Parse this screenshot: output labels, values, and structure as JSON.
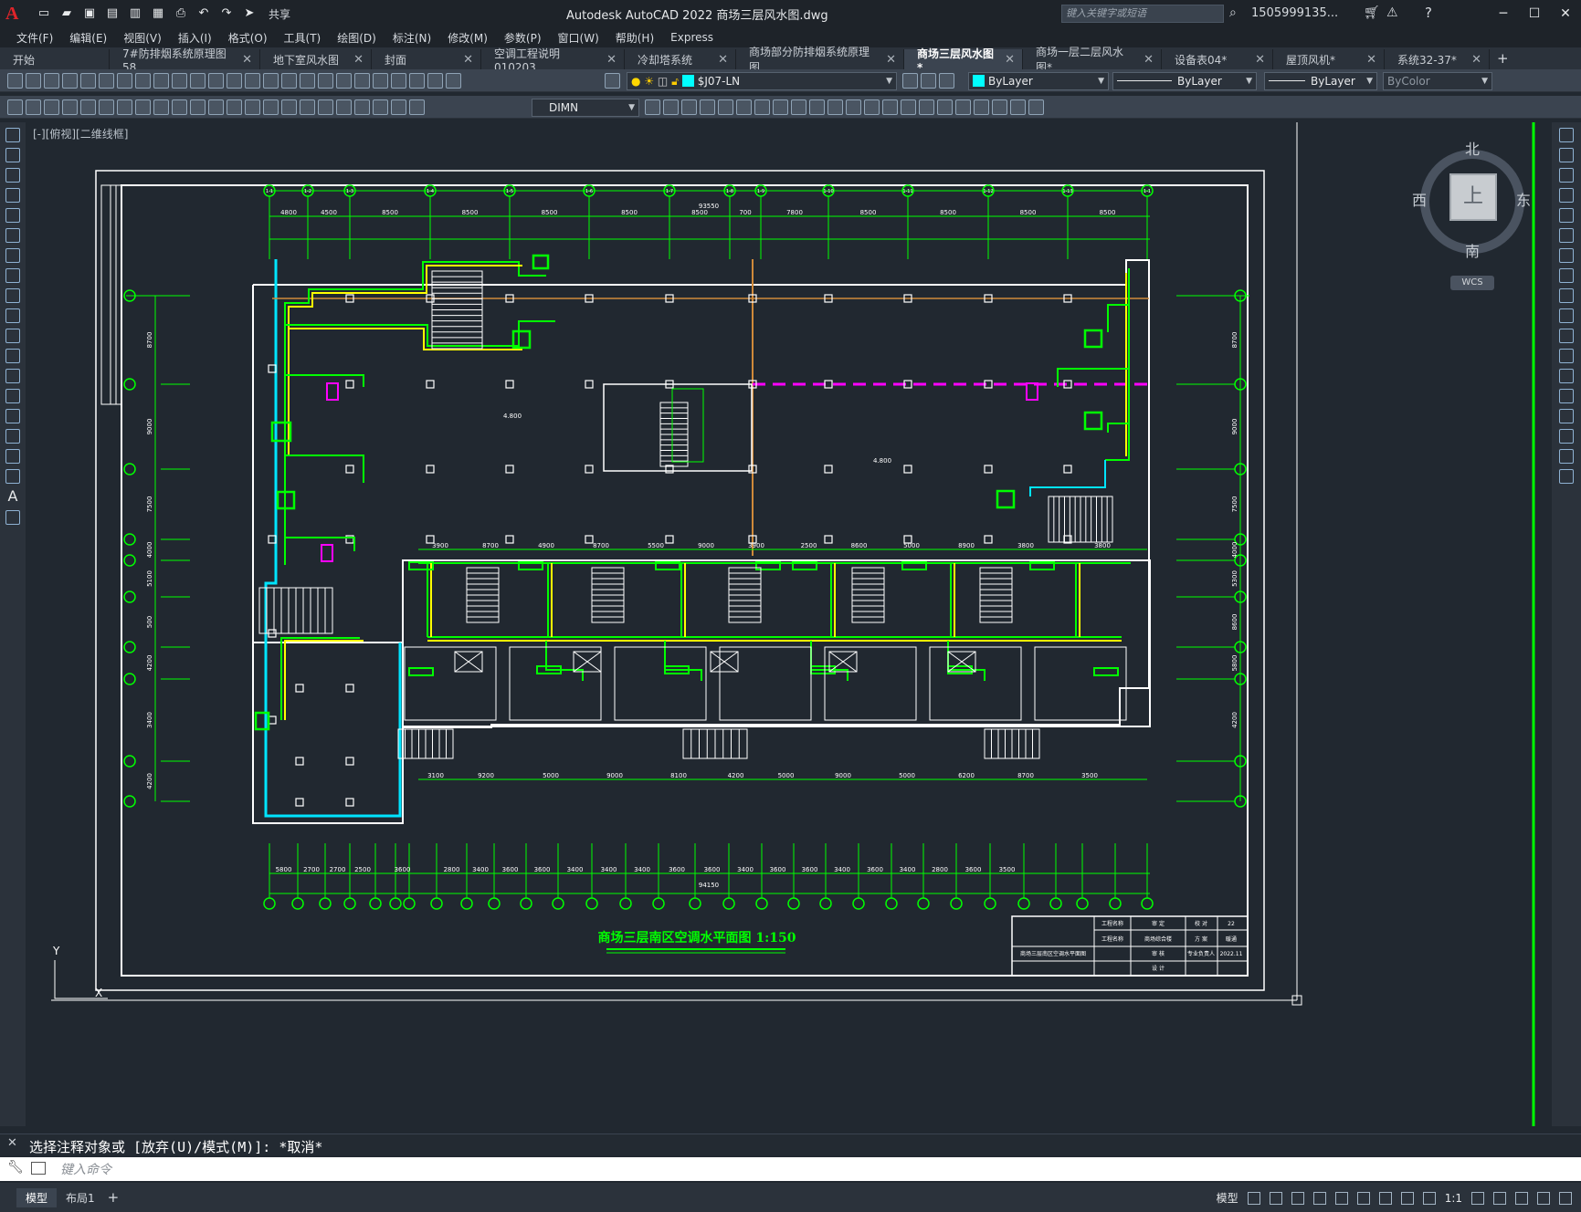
{
  "app": {
    "title": "Autodesk AutoCAD 2022   商场三层风水图.dwg",
    "share": "共享",
    "search_placeholder": "键入关键字或短语",
    "user": "1505999135...",
    "logo": "A"
  },
  "menu": [
    "文件(F)",
    "编辑(E)",
    "视图(V)",
    "插入(I)",
    "格式(O)",
    "工具(T)",
    "绘图(D)",
    "标注(N)",
    "修改(M)",
    "参数(P)",
    "窗口(W)",
    "帮助(H)",
    "Express"
  ],
  "tabs": [
    {
      "label": "开始",
      "closable": false
    },
    {
      "label": "7#防排烟系统原理图58",
      "closable": true
    },
    {
      "label": "地下室风水图",
      "closable": true
    },
    {
      "label": "封面",
      "closable": true
    },
    {
      "label": "空调工程说明010203",
      "closable": true
    },
    {
      "label": "冷却塔系统",
      "closable": true
    },
    {
      "label": "商场部分防排烟系统原理图",
      "closable": true
    },
    {
      "label": "商场三层风水图*",
      "closable": true,
      "active": true
    },
    {
      "label": "商场一层二层风水图*",
      "closable": true
    },
    {
      "label": "设备表04*",
      "closable": true
    },
    {
      "label": "屋顶风机*",
      "closable": true
    },
    {
      "label": "系统32-37*",
      "closable": true
    }
  ],
  "toolbar": {
    "layer": "$J07-LN",
    "layer_color": "#00ffff",
    "color": "ByLayer",
    "linetype": "ByLayer",
    "lineweight": "ByLayer",
    "plotstyle": "ByColor",
    "dimstyle": "DIMN"
  },
  "view_label": "[-][俯视][二维线框]",
  "viewcube": {
    "north": "北",
    "south": "南",
    "east": "东",
    "west": "西",
    "top": "上",
    "wcs": "WCS"
  },
  "drawing": {
    "title": "商场三层南区空调水平面图 1:150",
    "grid_top": [
      "1-1",
      "1-2",
      "1-3",
      "1-4",
      "1-5",
      "1-6",
      "1-7",
      "1-8",
      "1-9",
      "1-10",
      "1-11",
      "1-12",
      "1-13"
    ],
    "dims_top": [
      "4800",
      "4500",
      "8500",
      "8500",
      "8500",
      "8500",
      "8500",
      "700",
      "7800",
      "8500",
      "8500",
      "8500",
      "8500"
    ],
    "total_top": "93550",
    "dims_bottom": [
      "5800",
      "2700",
      "2700",
      "2500",
      "3600",
      "2800",
      "3400",
      "3600",
      "3600",
      "3400",
      "3400",
      "3400",
      "3600",
      "3600",
      "3400",
      "3600",
      "3600",
      "3400",
      "3600",
      "3400",
      "2800",
      "3600",
      "3500"
    ],
    "total_bottom": "94150",
    "left_dims": [
      "8700",
      "9000",
      "7500",
      "4000",
      "5100",
      "500",
      "4200",
      "3400",
      "4200"
    ],
    "right_dims": [
      "8700",
      "9000",
      "7500",
      "4000",
      "5300",
      "8600",
      "5800",
      "4200"
    ],
    "elev_label": "4.800",
    "mid_dims": [
      "3900",
      "8700",
      "4900",
      "8700",
      "5500",
      "9000",
      "3900",
      "2500",
      "8600",
      "5000",
      "8900",
      "3800",
      "3800"
    ],
    "low_dims": [
      "3100",
      "9200",
      "5000",
      "9000",
      "8100",
      "4200",
      "5000",
      "9000",
      "5000",
      "6200",
      "8700",
      "3500"
    ],
    "titleblock": {
      "project": "商场综合楼",
      "drawing_name": "商场三层南区空调水平面图",
      "sheet_no": "22",
      "date": "2022.11",
      "rows": [
        "工程名称",
        "工程名称",
        "审 定",
        "审 核",
        "设 计",
        "校 对",
        "方 案",
        "专业负责人",
        "图 号",
        "专 业",
        "日 期",
        "暖通"
      ]
    }
  },
  "command": {
    "history": "选择注释对象或 [放弃(U)/模式(M)]: *取消*",
    "placeholder": "键入命令"
  },
  "status": {
    "tabs": [
      "模型",
      "布局1"
    ],
    "model": "模型",
    "scale": "1:1"
  }
}
